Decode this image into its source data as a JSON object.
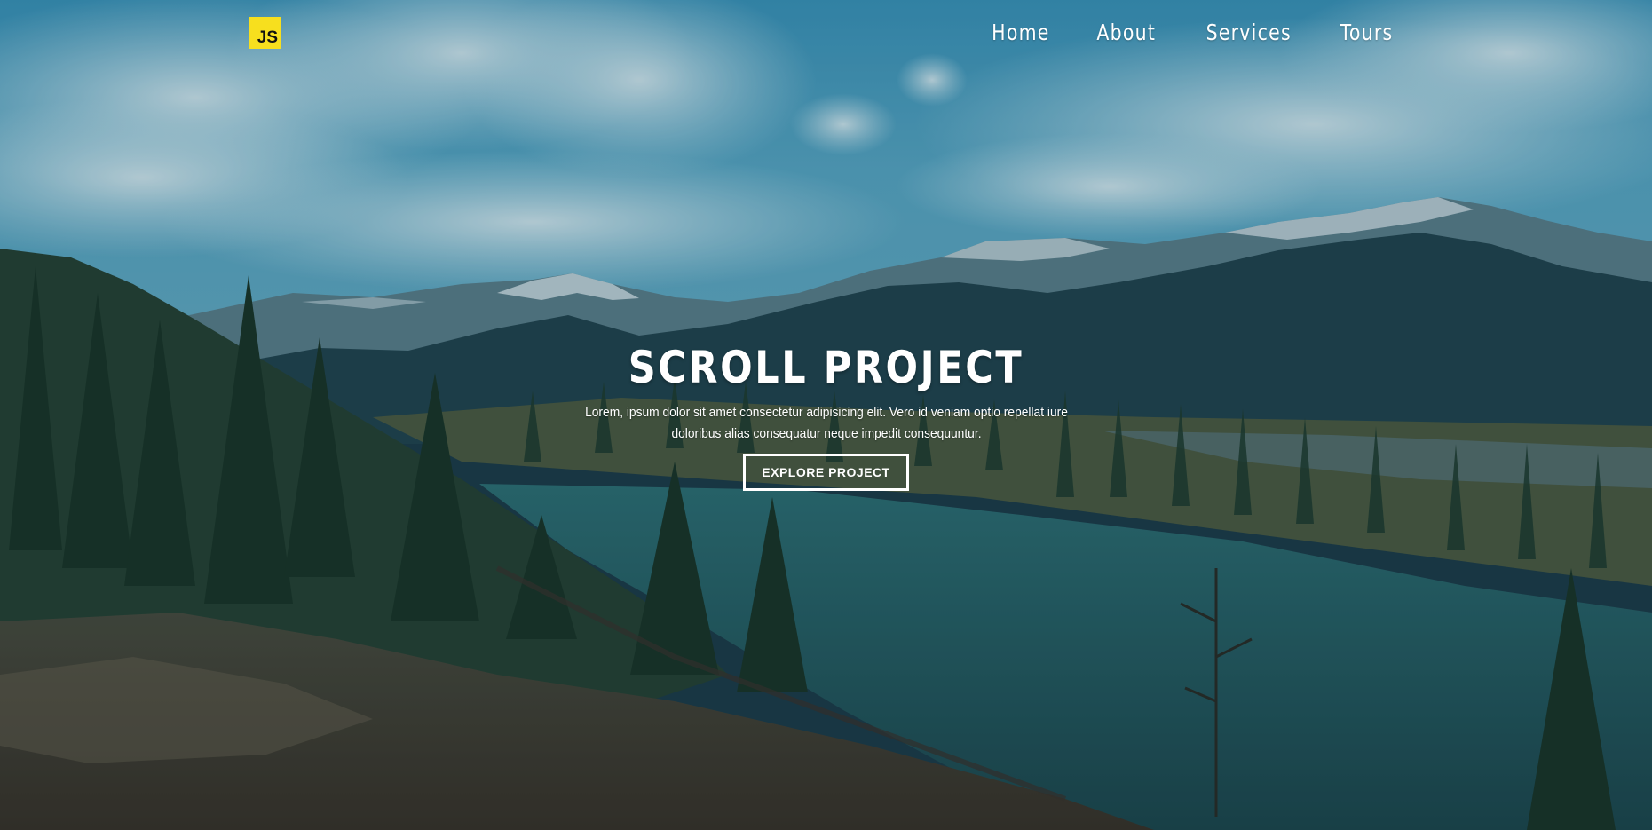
{
  "nav": {
    "logo_text": "JS",
    "links": [
      {
        "label": "Home"
      },
      {
        "label": "About"
      },
      {
        "label": "Services"
      },
      {
        "label": "Tours"
      }
    ]
  },
  "hero": {
    "title": "SCROLL PROJECT",
    "text": "Lorem, ipsum dolor sit amet consectetur adipisicing elit. Vero id veniam optio repellat iure doloribus alias consequatur neque impedit consequuntur.",
    "button_label": "EXPLORE PROJECT"
  },
  "colors": {
    "logo_bg": "#f7df1e",
    "sky": "#3d9cc0",
    "overlay": "rgba(8,40,60,0.18)",
    "text": "#ffffff"
  },
  "background_image": "mountain-lake-forest-photo"
}
